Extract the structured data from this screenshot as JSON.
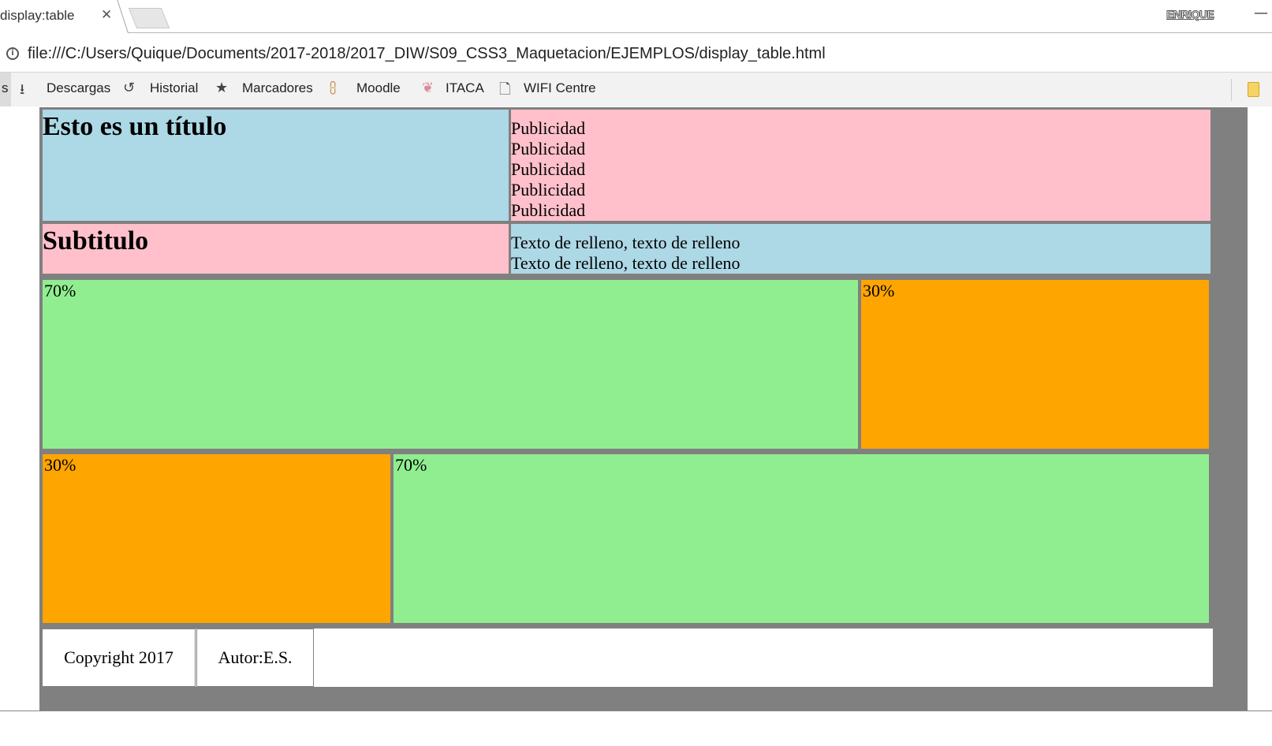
{
  "browser": {
    "tab_title": "display:table",
    "tab_close": "✕",
    "profile": "ENRIQUE",
    "minimize": "—",
    "url": "file:///C:/Users/Quique/Documents/2017-2018/2017_DIW/S09_CSS3_Maquetacion/EJEMPLOS/display_table.html",
    "bookmarks": {
      "edge_label": "s",
      "items": [
        "Descargas",
        "Historial",
        "Marcadores",
        "Moodle",
        "ITACA",
        "WIFI Centre"
      ]
    }
  },
  "page": {
    "title": "Esto es un título",
    "ads": [
      "Publicidad",
      "Publicidad",
      "Publicidad",
      "Publicidad",
      "Publicidad"
    ],
    "subtitle": "Subtitulo",
    "filler": [
      "Texto de relleno, texto de relleno",
      "Texto de relleno, texto de relleno"
    ],
    "row3": {
      "left": "70%",
      "right": "30%"
    },
    "row4": {
      "left": "30%",
      "right": "70%"
    },
    "footer": {
      "copyright": "Copyright 2017",
      "author": "Autor:E.S."
    }
  },
  "colors": {
    "blue": "#add8e6",
    "pink": "#ffc0cb",
    "green": "#90ee90",
    "orange": "#ffa500",
    "border": "#808080"
  }
}
